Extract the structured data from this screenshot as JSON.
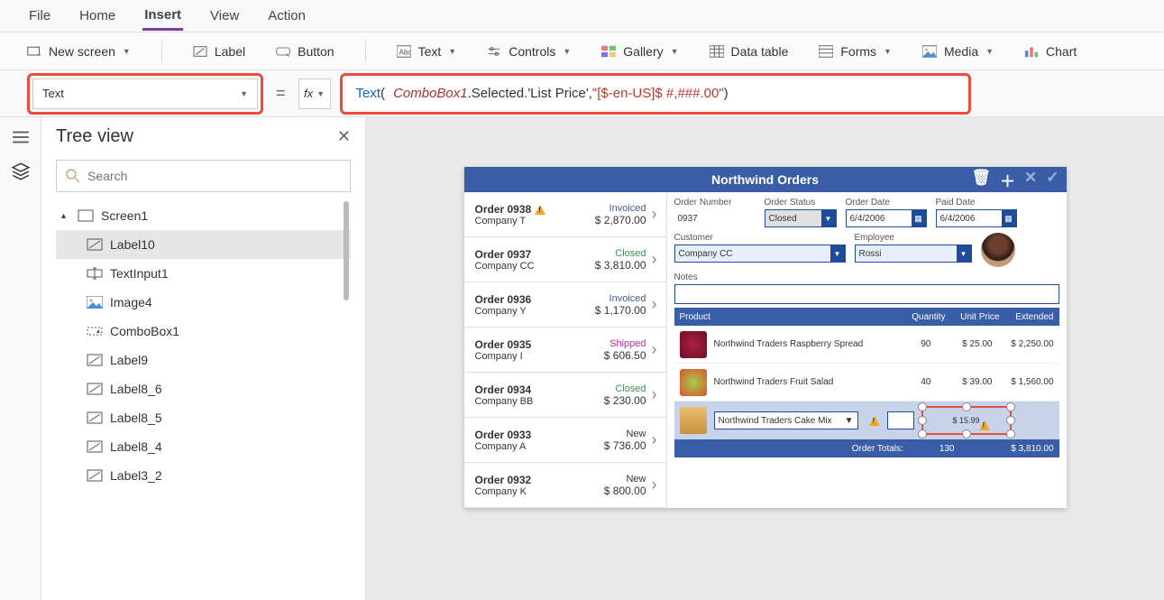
{
  "menu": {
    "file": "File",
    "home": "Home",
    "insert": "Insert",
    "view": "View",
    "action": "Action"
  },
  "ribbon": {
    "newscreen": "New screen",
    "label": "Label",
    "button": "Button",
    "text": "Text",
    "controls": "Controls",
    "gallery": "Gallery",
    "datatable": "Data table",
    "forms": "Forms",
    "media": "Media",
    "chart": "Chart"
  },
  "fbar": {
    "property": "Text",
    "equals": "=",
    "fx": "fx",
    "fn": "Text",
    "p1": "(",
    "obj": "ComboBox1",
    "tail": ".Selected.'List Price', ",
    "str": "\"[$-en-US]$ #,###.00\"",
    "p2": " )"
  },
  "tree": {
    "title": "Tree view",
    "search_placeholder": "Search",
    "root": "Screen1",
    "items": [
      "Label10",
      "TextInput1",
      "Image4",
      "ComboBox1",
      "Label9",
      "Label8_6",
      "Label8_5",
      "Label8_4",
      "Label3_2"
    ]
  },
  "app": {
    "title": "Northwind Orders",
    "orders": [
      {
        "id": "Order 0938",
        "co": "Company T",
        "status": "Invoiced",
        "cls": "st-invoiced",
        "price": "$ 2,870.00",
        "warn": true
      },
      {
        "id": "Order 0937",
        "co": "Company CC",
        "status": "Closed",
        "cls": "st-closed",
        "price": "$ 3,810.00"
      },
      {
        "id": "Order 0936",
        "co": "Company Y",
        "status": "Invoiced",
        "cls": "st-invoiced",
        "price": "$ 1,170.00"
      },
      {
        "id": "Order 0935",
        "co": "Company I",
        "status": "Shipped",
        "cls": "st-shipped",
        "price": "$ 606.50"
      },
      {
        "id": "Order 0934",
        "co": "Company BB",
        "status": "Closed",
        "cls": "st-closed",
        "price": "$ 230.00"
      },
      {
        "id": "Order 0933",
        "co": "Company A",
        "status": "New",
        "cls": "st-new",
        "price": "$ 736.00"
      },
      {
        "id": "Order 0932",
        "co": "Company K",
        "status": "New",
        "cls": "st-new",
        "price": "$ 800.00"
      }
    ],
    "form": {
      "order_number_label": "Order Number",
      "order_number": "0937",
      "order_status_label": "Order Status",
      "order_status": "Closed",
      "order_date_label": "Order Date",
      "order_date": "6/4/2006",
      "paid_date_label": "Paid Date",
      "paid_date": "6/4/2006",
      "customer_label": "Customer",
      "customer": "Company CC",
      "employee_label": "Employee",
      "employee": "Rossi",
      "notes_label": "Notes"
    },
    "prod_head": {
      "product": "Product",
      "qty": "Quantity",
      "unit": "Unit Price",
      "ext": "Extended"
    },
    "products": [
      {
        "name": "Northwind Traders Raspberry Spread",
        "qty": "90",
        "unit": "$ 25.00",
        "ext": "$ 2,250.00",
        "bg": "radial-gradient(circle,#b02045,#6a0f25)"
      },
      {
        "name": "Northwind Traders Fruit Salad",
        "qty": "40",
        "unit": "$ 39.00",
        "ext": "$ 1,560.00",
        "bg": "radial-gradient(circle,#a8cf4a,#d9502e)"
      }
    ],
    "newrow": {
      "product": "Northwind Traders Cake Mix",
      "price": "$ 15.99"
    },
    "totals": {
      "label": "Order Totals:",
      "qty": "130",
      "amount": "$ 3,810.00"
    }
  }
}
